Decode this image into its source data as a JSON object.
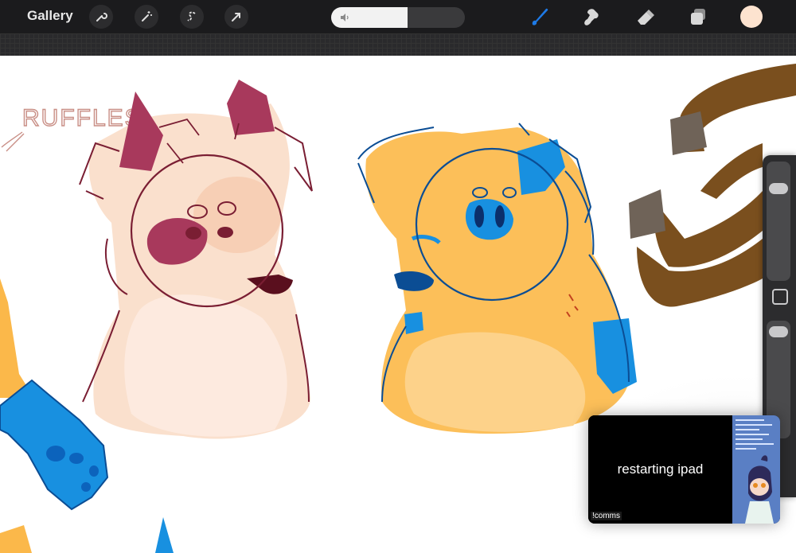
{
  "toolbar": {
    "gallery_label": "Gallery",
    "left_tools": [
      "wrench-icon",
      "magic-wand-icon",
      "selection-s-icon",
      "transform-arrow-icon"
    ],
    "volume_level": 0.57,
    "right_tools": [
      "brush-icon",
      "smudge-icon",
      "eraser-icon",
      "layers-icon"
    ],
    "active_tool": "brush-icon",
    "current_color": "#fde3cf",
    "accent_color": "#1e7ae6"
  },
  "canvas": {
    "sketch_text": "RUFFLES"
  },
  "sidebar": {
    "brush_size_level": 0.8,
    "opacity_level": 0.95
  },
  "pip": {
    "message": "restarting ipad",
    "overlay_text": "!comms"
  }
}
